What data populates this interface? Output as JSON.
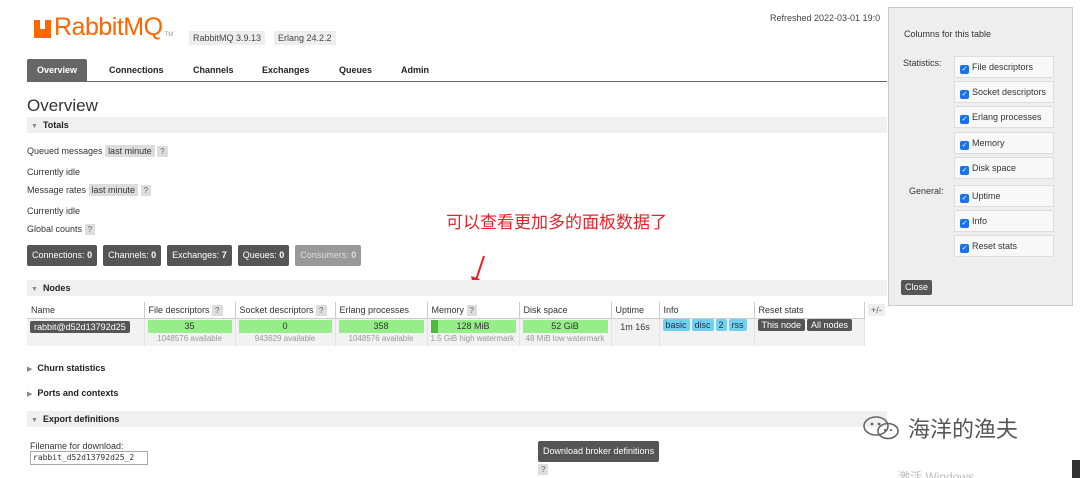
{
  "header": {
    "logo_text": "RabbitMQ",
    "logo_tm": "TM",
    "rabbitmq_version": "RabbitMQ 3.9.13",
    "erlang_version": "Erlang 24.2.2",
    "refreshed": "Refreshed 2022-03-01 19:0"
  },
  "tabs": [
    "Overview",
    "Connections",
    "Channels",
    "Exchanges",
    "Queues",
    "Admin"
  ],
  "page_title": "Overview",
  "totals": {
    "heading": "Totals",
    "queued_label": "Queued messages",
    "queued_range": "last minute",
    "help": "?",
    "idle1": "Currently idle",
    "rates_label": "Message rates",
    "rates_range": "last minute",
    "idle2": "Currently idle",
    "global_counts": "Global counts"
  },
  "counts": [
    {
      "label": "Connections:",
      "value": "0"
    },
    {
      "label": "Channels:",
      "value": "0"
    },
    {
      "label": "Exchanges:",
      "value": "7"
    },
    {
      "label": "Queues:",
      "value": "0"
    },
    {
      "label": "Consumers:",
      "value": "0"
    }
  ],
  "annotation": "可以查看更加多的面板数据了",
  "nodes": {
    "heading": "Nodes",
    "columns": [
      "Name",
      "File descriptors",
      "Socket descriptors",
      "Erlang processes",
      "Memory",
      "Disk space",
      "Uptime",
      "Info",
      "Reset stats"
    ],
    "row": {
      "name": "rabbit@d52d13792d25",
      "fd": "35",
      "fd_sub": "1048576 available",
      "sd": "0",
      "sd_sub": "943629 available",
      "ep": "358",
      "ep_sub": "1048576 available",
      "mem": "128 MiB",
      "mem_sub": "1.5 GiB high watermark",
      "disk": "52 GiB",
      "disk_sub": "48 MiB low watermark",
      "uptime": "1m 16s",
      "info": [
        "basic",
        "disc",
        "2",
        "rss"
      ],
      "reset": [
        "This node",
        "All nodes"
      ]
    },
    "plusminus": "+/-"
  },
  "sections": {
    "churn": "Churn statistics",
    "ports": "Ports and contexts",
    "export": "Export definitions"
  },
  "export": {
    "filename_label": "Filename for download:",
    "filename_value": "rabbit_d52d13792d25_2",
    "download_button": "Download broker definitions"
  },
  "columns_panel": {
    "title": "Columns for this table",
    "statistics_label": "Statistics:",
    "general_label": "General:",
    "statistics": [
      "File descriptors",
      "Socket descriptors",
      "Erlang processes",
      "Memory",
      "Disk space"
    ],
    "general": [
      "Uptime",
      "Info",
      "Reset stats"
    ],
    "close": "Close"
  },
  "watermark": {
    "text": "海洋的渔夫",
    "activate": "激活 Windows"
  }
}
